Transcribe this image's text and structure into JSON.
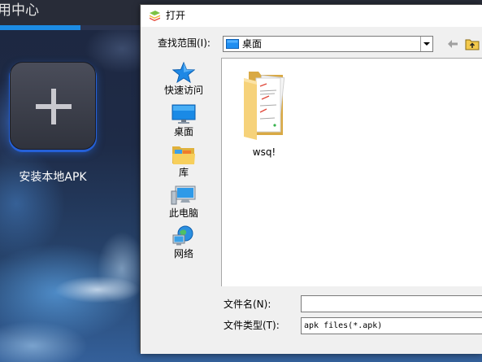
{
  "app": {
    "title": "用中心",
    "tile": {
      "icon": "plus-icon",
      "label": "安装本地APK"
    }
  },
  "dialog": {
    "title": "打开",
    "app_icon": "bluestacks-icon",
    "look_in": {
      "label": "查找范围(I):",
      "value": "桌面",
      "icon": "desktop-icon"
    },
    "toolbar": [
      {
        "icon": "back-arrow-icon",
        "enabled": false
      },
      {
        "icon": "up-folder-icon",
        "enabled": true
      }
    ],
    "places": [
      {
        "label": "快速访问",
        "icon": "star-icon"
      },
      {
        "label": "桌面",
        "icon": "desktop-icon"
      },
      {
        "label": "库",
        "icon": "library-icon"
      },
      {
        "label": "此电脑",
        "icon": "computer-icon"
      },
      {
        "label": "网络",
        "icon": "network-icon"
      }
    ],
    "files": [
      {
        "name": "wsq!",
        "type": "folder",
        "icon": "folder-icon"
      }
    ],
    "file_name": {
      "label": "文件名(N):",
      "value": ""
    },
    "file_type": {
      "label": "文件类型(T):",
      "value": "apk files(*.apk)"
    }
  },
  "colors": {
    "accent_blue": "#1c8be3",
    "tile_glow": "#2560d8",
    "dialog_background": "#f0f0f0",
    "folder_yellow": "#f6d27a"
  }
}
